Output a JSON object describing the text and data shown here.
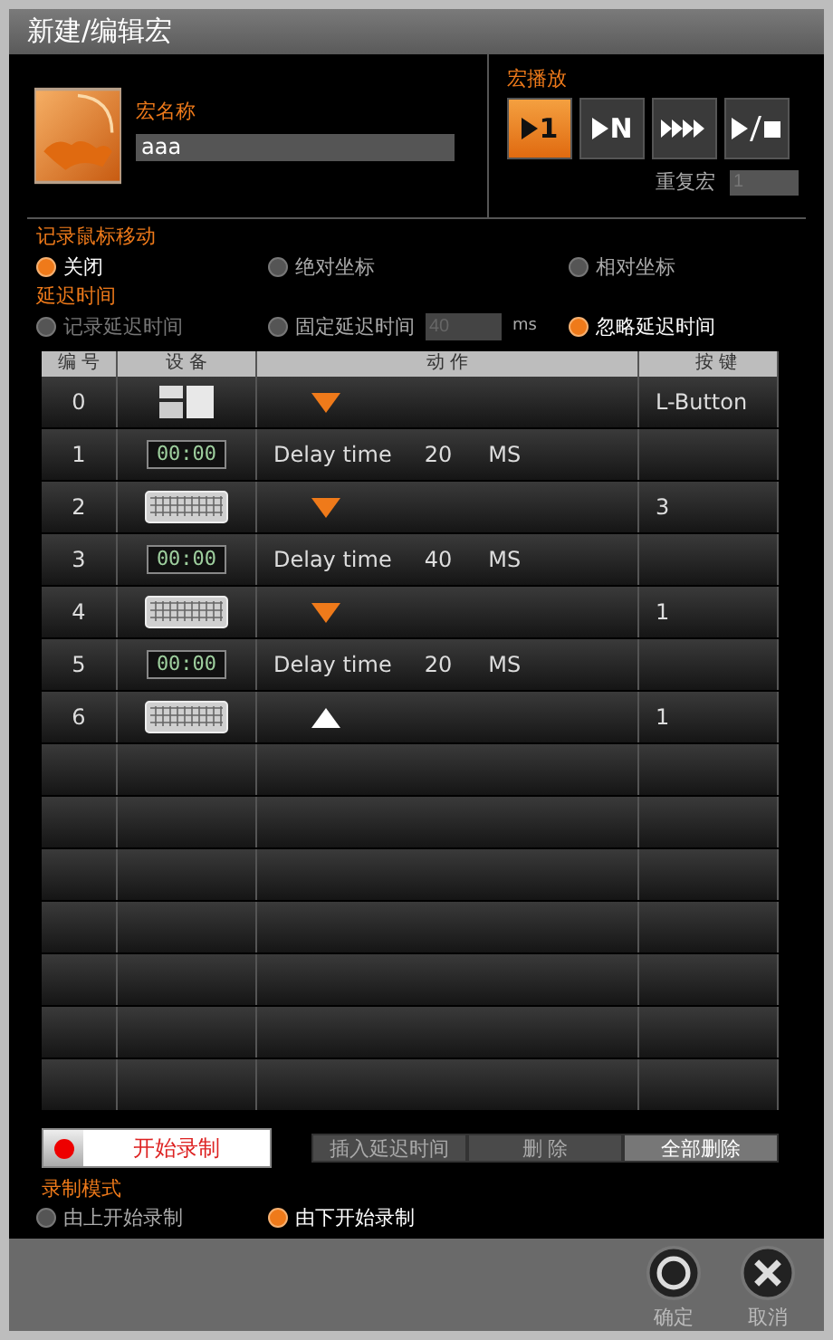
{
  "window": {
    "title": "新建/编辑宏"
  },
  "macro_name": {
    "label": "宏名称",
    "value": "aaa"
  },
  "playback": {
    "label": "宏播放",
    "modes": [
      {
        "kind": "once",
        "label": "1",
        "selected": true
      },
      {
        "kind": "n_times",
        "label": "N",
        "selected": false
      },
      {
        "kind": "loop",
        "selected": false
      },
      {
        "kind": "toggle",
        "selected": false
      }
    ],
    "repeat_label": "重复宏",
    "repeat_value": "1"
  },
  "mouse_move": {
    "label": "记录鼠标移动",
    "options": [
      {
        "label": "关闭",
        "selected": true
      },
      {
        "label": "绝对坐标",
        "selected": false
      },
      {
        "label": "相对坐标",
        "selected": false
      }
    ]
  },
  "delay": {
    "label": "延迟时间",
    "options": [
      {
        "label": "记录延迟时间",
        "selected": false,
        "disabled": true
      },
      {
        "label": "固定延迟时间",
        "selected": false,
        "disabled": false,
        "field_value": "40",
        "unit": "ms"
      },
      {
        "label": "忽略延迟时间",
        "selected": true,
        "disabled": false
      }
    ]
  },
  "table": {
    "columns": [
      "编 号",
      "设 备",
      "动 作",
      "按 键"
    ],
    "rows": [
      {
        "number": "0",
        "device": {
          "kind": "mouse"
        },
        "action": {
          "kind": "press"
        },
        "key": "L-Button"
      },
      {
        "number": "1",
        "device": {
          "kind": "timer",
          "text": "00:00"
        },
        "action": {
          "kind": "delay",
          "label": "Delay time",
          "value": "20",
          "unit": "MS"
        }
      },
      {
        "number": "2",
        "device": {
          "kind": "keyboard"
        },
        "action": {
          "kind": "press"
        },
        "key": "3"
      },
      {
        "number": "3",
        "device": {
          "kind": "timer",
          "text": "00:00"
        },
        "action": {
          "kind": "delay",
          "label": "Delay time",
          "value": "40",
          "unit": "MS"
        }
      },
      {
        "number": "4",
        "device": {
          "kind": "keyboard"
        },
        "action": {
          "kind": "press"
        },
        "key": "1"
      },
      {
        "number": "5",
        "device": {
          "kind": "timer",
          "text": "00:00"
        },
        "action": {
          "kind": "delay",
          "label": "Delay time",
          "value": "20",
          "unit": "MS"
        }
      },
      {
        "number": "6",
        "device": {
          "kind": "keyboard"
        },
        "action": {
          "kind": "release"
        },
        "key": "1"
      }
    ]
  },
  "record_button": "开始录制",
  "edit_buttons": [
    {
      "label": "插入延迟时间",
      "selected": false
    },
    {
      "label": "删 除",
      "selected": false
    },
    {
      "label": "全部删除",
      "selected": true
    }
  ],
  "record_mode": {
    "label": "录制模式",
    "options": [
      {
        "label": "由上开始录制",
        "selected": false
      },
      {
        "label": "由下开始录制",
        "selected": true
      }
    ]
  },
  "footer_buttons": [
    {
      "kind": "ok",
      "label": "确定"
    },
    {
      "kind": "cancel",
      "label": "取消"
    }
  ]
}
